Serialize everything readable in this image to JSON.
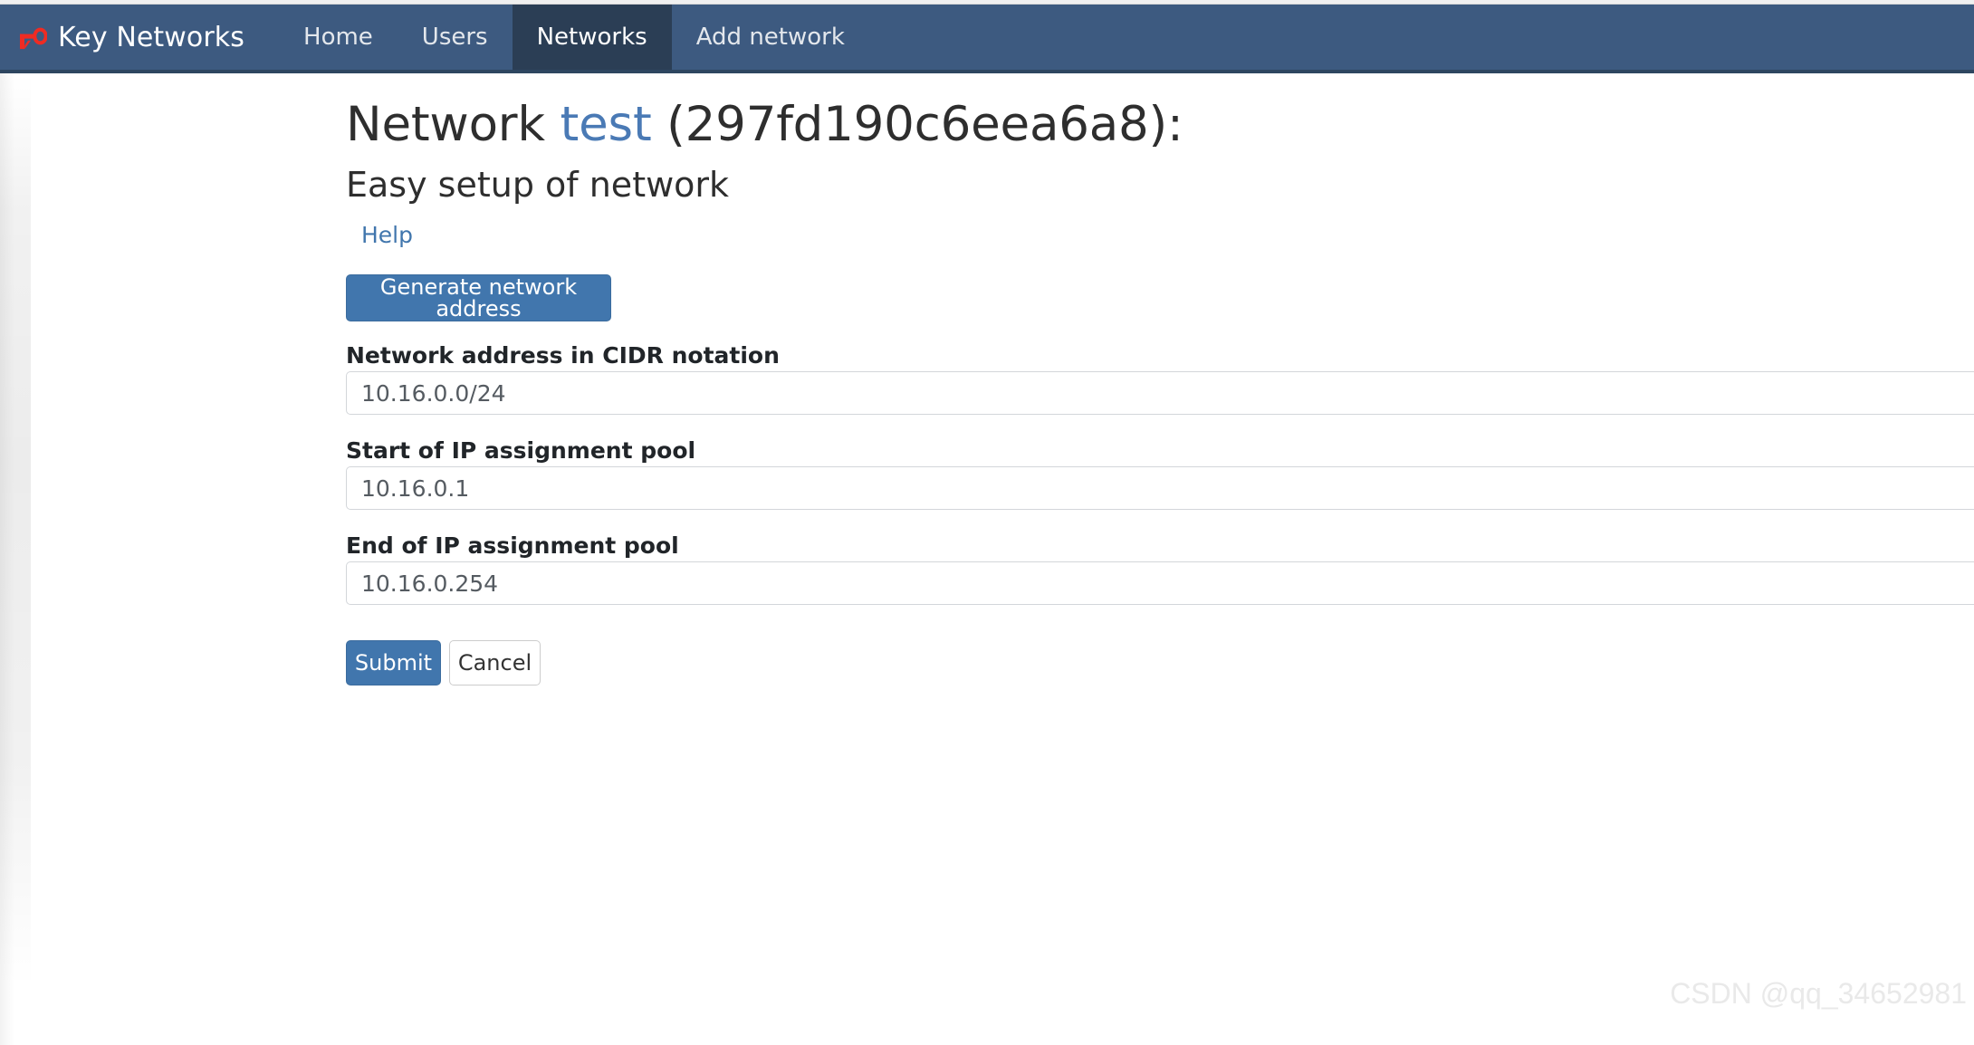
{
  "navbar": {
    "brand": {
      "label": "Key Networks",
      "icon": "key-icon",
      "icon_color": "#ef2b23"
    },
    "background_color": "#3d5a80",
    "active_background_color": "#2b3e55",
    "links": [
      {
        "label": "Home",
        "active": false
      },
      {
        "label": "Users",
        "active": false
      },
      {
        "label": "Networks",
        "active": true
      },
      {
        "label": "Add network",
        "active": false
      }
    ]
  },
  "page": {
    "title_prefix": "Network ",
    "network_name": "test",
    "title_suffix": " (297fd190c6eea6a8):",
    "network_id": "297fd190c6eea6a8",
    "subtitle": "Easy setup of network",
    "help_link": "Help",
    "accent_color": "#4176ad",
    "link_color": "#4a7ab5"
  },
  "form": {
    "generate_button": "Generate network address",
    "fields": [
      {
        "label": "Network address in CIDR notation",
        "value": "10.16.0.0/24",
        "placeholder": "Network address in CIDR notation"
      },
      {
        "label": "Start of IP assignment pool",
        "value": "10.16.0.1",
        "placeholder": "Start of IP assignment pool"
      },
      {
        "label": "End of IP assignment pool",
        "value": "10.16.0.254",
        "placeholder": "End of IP assignment pool"
      }
    ],
    "submit_button": "Submit",
    "cancel_button": "Cancel"
  },
  "watermark": {
    "text": "CSDN @qq_34652981"
  }
}
